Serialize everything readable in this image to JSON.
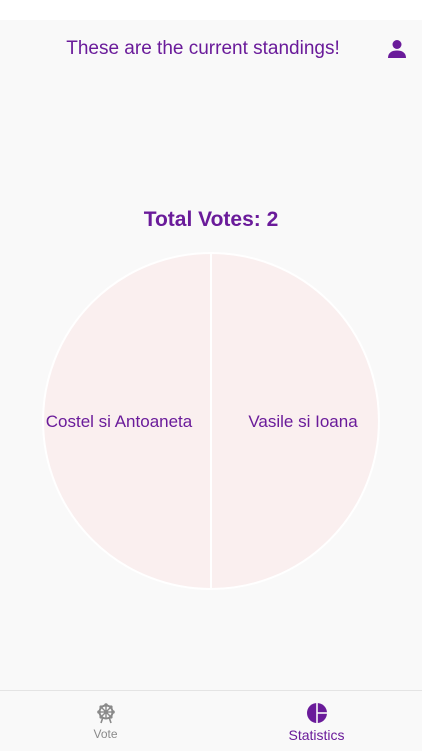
{
  "header": {
    "title": "These are the current standings!",
    "profile_icon": "person-icon"
  },
  "stats": {
    "total_label": "Total Votes: 2"
  },
  "chart_data": {
    "type": "pie",
    "categories": [
      "Costel si Antoaneta",
      "Vasile si Ioana"
    ],
    "values": [
      1,
      1
    ],
    "colors": [
      "#faefef",
      "#faefef"
    ],
    "label_color": "#6a1b9a"
  },
  "tabs": [
    {
      "label": "Vote",
      "icon": "ferris-wheel-icon",
      "active": false
    },
    {
      "label": "Statistics",
      "icon": "pie-chart-icon",
      "active": true
    }
  ],
  "colors": {
    "accent": "#6a1b9a",
    "inactive": "#8a8a8a",
    "background": "#f9f9f9",
    "slice": "#faefef"
  }
}
